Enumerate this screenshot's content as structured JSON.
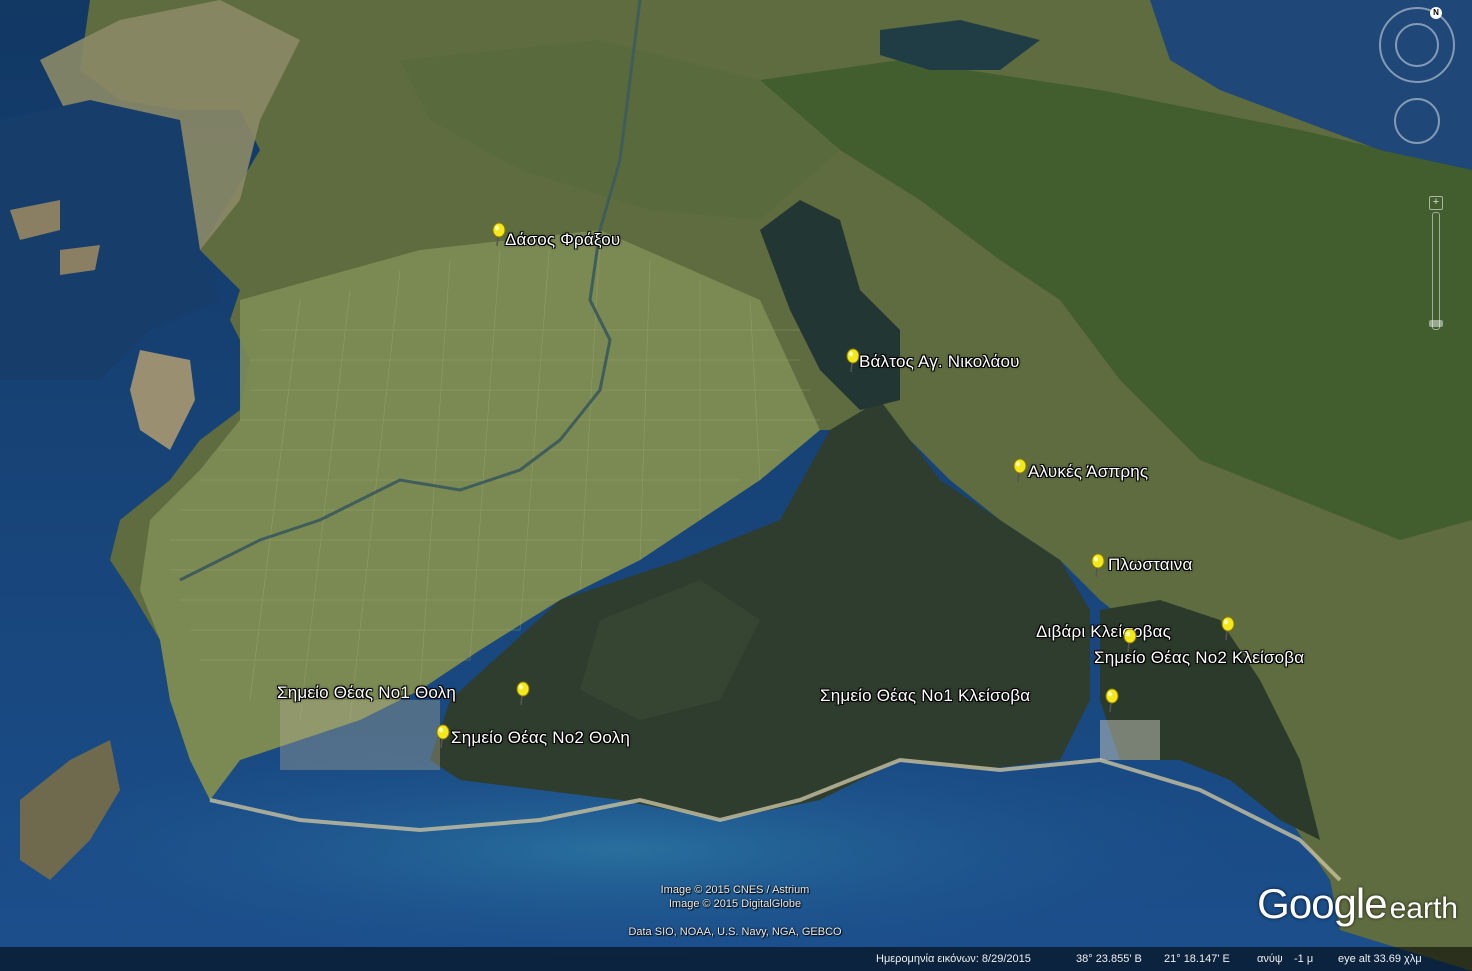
{
  "app": {
    "name": "Google earth",
    "brand_word1": "Google",
    "brand_word2": "earth"
  },
  "colors": {
    "sea": "#1f4d86",
    "lagoon": "#2c3a2b",
    "pin": "#f4e81d",
    "label": "#ffffff"
  },
  "placemarks": [
    {
      "label": "Δάσος Φράξου",
      "icon": "yellow-pushpin-icon"
    },
    {
      "label": "Βάλτος Αγ. Νικολάου",
      "icon": "yellow-pushpin-icon"
    },
    {
      "label": "Αλυκές Άσπρης",
      "icon": "yellow-pushpin-icon"
    },
    {
      "label": "Πλωσταινα",
      "icon": "yellow-pushpin-icon"
    },
    {
      "label": "Διβάρι Κλείσοβας",
      "icon": "yellow-pushpin-icon"
    },
    {
      "label": "Σημείο Θέας Νο2 Κλείσοβα",
      "icon": "yellow-pushpin-icon"
    },
    {
      "label": "Σημείο Θέας Νο1 Κλείσοβα",
      "icon": "yellow-pushpin-icon"
    },
    {
      "label": "Σημείο Θέας Νο1 Θολη",
      "icon": "yellow-pushpin-icon"
    },
    {
      "label": "Σημείο Θέας Νο2 Θολη",
      "icon": "yellow-pushpin-icon"
    }
  ],
  "credits": {
    "line1": "Image © 2015 CNES / Astrium",
    "line2": "Image © 2015 DigitalGlobe",
    "line3": "Data SIO, NOAA, U.S. Navy, NGA, GEBCO"
  },
  "statusbar": {
    "imagery_date": "Ημερομηνία εικόνων: 8/29/2015",
    "latitude": "38° 23.855' Β",
    "longitude": "21° 18.147' Ε",
    "elevation_label": "ανύψ",
    "elevation": "-1 μ",
    "eye_alt": "eye alt  33.69 χλμ"
  },
  "navigation": {
    "north_label": "N",
    "zoom_in": "+",
    "zoom_out": "−",
    "icons": [
      "compass-ring-icon",
      "look-joystick-icon",
      "move-joystick-icon",
      "zoom-slider-icon"
    ]
  }
}
